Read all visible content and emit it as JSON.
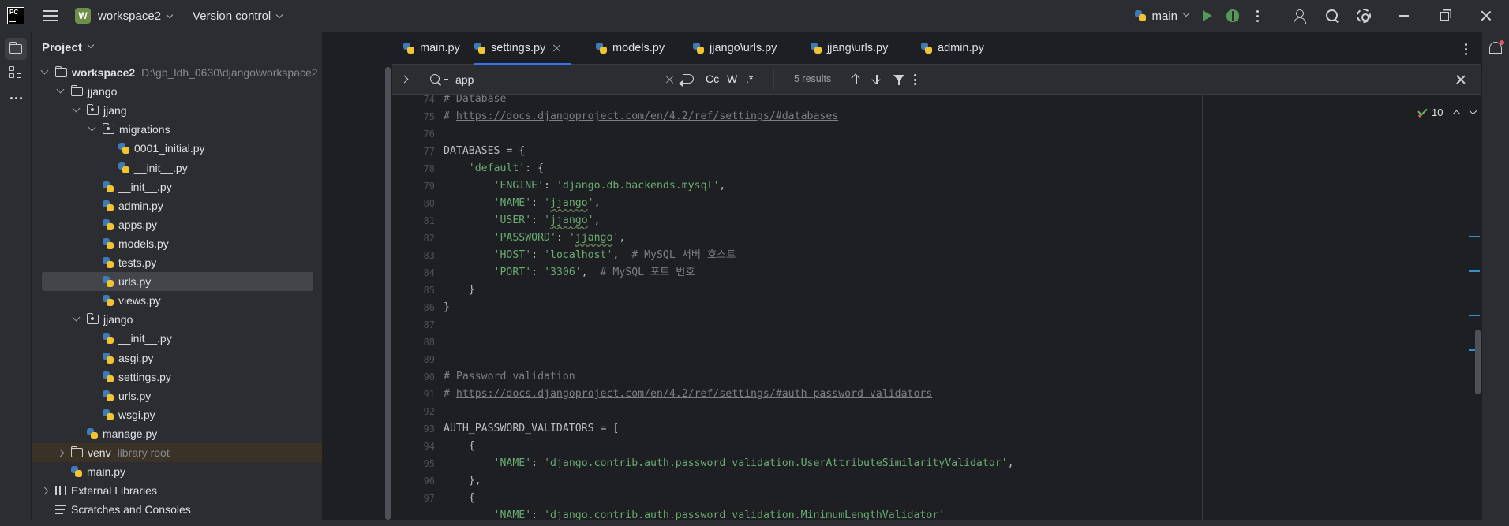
{
  "titlebar": {
    "logo_text": "PC",
    "project_badge": "W",
    "project_name": "workspace2",
    "vcs_label": "Version control",
    "run_config": "main"
  },
  "project_panel": {
    "title": "Project",
    "tree": [
      {
        "label": "workspace2",
        "path": "D:\\gb_ldh_0630\\django\\workspace2",
        "type": "folder",
        "level": 0,
        "expanded": true
      },
      {
        "label": "jjango",
        "type": "folder",
        "level": 1,
        "expanded": true
      },
      {
        "label": "jjang",
        "type": "package",
        "level": 2,
        "expanded": true
      },
      {
        "label": "migrations",
        "type": "package",
        "level": 3,
        "expanded": true
      },
      {
        "label": "0001_initial.py",
        "type": "py",
        "level": 4
      },
      {
        "label": "__init__.py",
        "type": "py",
        "level": 4
      },
      {
        "label": "__init__.py",
        "type": "py",
        "level": 3
      },
      {
        "label": "admin.py",
        "type": "py",
        "level": 3
      },
      {
        "label": "apps.py",
        "type": "py",
        "level": 3
      },
      {
        "label": "models.py",
        "type": "py",
        "level": 3
      },
      {
        "label": "tests.py",
        "type": "py",
        "level": 3
      },
      {
        "label": "urls.py",
        "type": "py",
        "level": 3,
        "selected": true
      },
      {
        "label": "views.py",
        "type": "py",
        "level": 3
      },
      {
        "label": "jjango",
        "type": "package",
        "level": 2,
        "expanded": true
      },
      {
        "label": "__init__.py",
        "type": "py",
        "level": 3
      },
      {
        "label": "asgi.py",
        "type": "py",
        "level": 3
      },
      {
        "label": "settings.py",
        "type": "py",
        "level": 3
      },
      {
        "label": "urls.py",
        "type": "py",
        "level": 3
      },
      {
        "label": "wsgi.py",
        "type": "py",
        "level": 3
      },
      {
        "label": "manage.py",
        "type": "py",
        "level": 2
      },
      {
        "label": "venv",
        "path": "library root",
        "type": "folder",
        "level": 1,
        "expanded": false,
        "venv": true
      },
      {
        "label": "main.py",
        "type": "py",
        "level": 1
      },
      {
        "label": "External Libraries",
        "type": "lib",
        "level": 0,
        "expanded": false
      },
      {
        "label": "Scratches and Consoles",
        "type": "scratch",
        "level": 0
      }
    ]
  },
  "tabs": [
    {
      "label": "main.py",
      "active": false
    },
    {
      "label": "settings.py",
      "active": true
    },
    {
      "label": "models.py",
      "active": false
    },
    {
      "label": "jjango\\urls.py",
      "active": false
    },
    {
      "label": "jjang\\urls.py",
      "active": false
    },
    {
      "label": "admin.py",
      "active": false
    }
  ],
  "find": {
    "query": "app",
    "match_case": "Cc",
    "words": "W",
    "regex": ".*",
    "results": "5 results"
  },
  "inspections": {
    "count": "10"
  },
  "code": {
    "line_numbers": [
      "74",
      "75",
      "76",
      "77",
      "78",
      "79",
      "80",
      "81",
      "82",
      "83",
      "84",
      "85",
      "86",
      "87",
      "88",
      "89",
      "90",
      "91",
      "92",
      "93",
      "94",
      "95",
      "96",
      "97"
    ],
    "l74": "# Database",
    "l75_hash": "# ",
    "l75_link": "https://docs.djangoproject.com/en/4.2/ref/settings/#databases",
    "l77": "DATABASES = {",
    "l78_key": "'default'",
    "l78_rest": ": {",
    "l79_key": "'ENGINE'",
    "l79_val": "'django.db.backends.mysql'",
    "l80_key": "'NAME'",
    "l80_val_q": "'",
    "l80_val": "jjango",
    "l81_key": "'USER'",
    "l81_val": "jjango",
    "l82_key": "'PASSWORD'",
    "l82_val": "jjango",
    "l83_key": "'HOST'",
    "l83_val": "'localhost'",
    "l83_com": "# MySQL 서버 호스트",
    "l84_key": "'PORT'",
    "l84_val": "'3306'",
    "l84_com": "# MySQL 포트 번호",
    "l85": "}",
    "l86": "}",
    "l89": "# Password validation",
    "l90_hash": "# ",
    "l90_link": "https://docs.djangoproject.com/en/4.2/ref/settings/#auth-password-validators",
    "l92": "AUTH_PASSWORD_VALIDATORS = [",
    "l93": "{",
    "l94_key": "'NAME'",
    "l94_val": "'django.contrib.auth.password_validation.UserAttributeSimilarityValidator'",
    "l95": "},",
    "l96": "{",
    "l97_key": "'NAME'",
    "l97_val": "'django.contrib.auth.password_validation.MinimumLengthValidator'"
  }
}
